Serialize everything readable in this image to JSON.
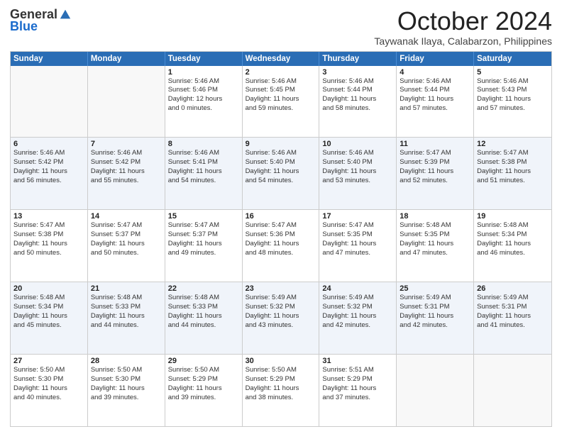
{
  "logo": {
    "general": "General",
    "blue": "Blue"
  },
  "title": "October 2024",
  "subtitle": "Taywanak Ilaya, Calabarzon, Philippines",
  "headers": [
    "Sunday",
    "Monday",
    "Tuesday",
    "Wednesday",
    "Thursday",
    "Friday",
    "Saturday"
  ],
  "weeks": [
    [
      {
        "day": "",
        "sunrise": "",
        "sunset": "",
        "daylight": "",
        "mins": "",
        "empty": true
      },
      {
        "day": "",
        "sunrise": "",
        "sunset": "",
        "daylight": "",
        "mins": "",
        "empty": true
      },
      {
        "day": "1",
        "sunrise": "Sunrise: 5:46 AM",
        "sunset": "Sunset: 5:46 PM",
        "daylight": "Daylight: 12 hours",
        "mins": "and 0 minutes."
      },
      {
        "day": "2",
        "sunrise": "Sunrise: 5:46 AM",
        "sunset": "Sunset: 5:45 PM",
        "daylight": "Daylight: 11 hours",
        "mins": "and 59 minutes."
      },
      {
        "day": "3",
        "sunrise": "Sunrise: 5:46 AM",
        "sunset": "Sunset: 5:44 PM",
        "daylight": "Daylight: 11 hours",
        "mins": "and 58 minutes."
      },
      {
        "day": "4",
        "sunrise": "Sunrise: 5:46 AM",
        "sunset": "Sunset: 5:44 PM",
        "daylight": "Daylight: 11 hours",
        "mins": "and 57 minutes."
      },
      {
        "day": "5",
        "sunrise": "Sunrise: 5:46 AM",
        "sunset": "Sunset: 5:43 PM",
        "daylight": "Daylight: 11 hours",
        "mins": "and 57 minutes."
      }
    ],
    [
      {
        "day": "6",
        "sunrise": "Sunrise: 5:46 AM",
        "sunset": "Sunset: 5:42 PM",
        "daylight": "Daylight: 11 hours",
        "mins": "and 56 minutes."
      },
      {
        "day": "7",
        "sunrise": "Sunrise: 5:46 AM",
        "sunset": "Sunset: 5:42 PM",
        "daylight": "Daylight: 11 hours",
        "mins": "and 55 minutes."
      },
      {
        "day": "8",
        "sunrise": "Sunrise: 5:46 AM",
        "sunset": "Sunset: 5:41 PM",
        "daylight": "Daylight: 11 hours",
        "mins": "and 54 minutes."
      },
      {
        "day": "9",
        "sunrise": "Sunrise: 5:46 AM",
        "sunset": "Sunset: 5:40 PM",
        "daylight": "Daylight: 11 hours",
        "mins": "and 54 minutes."
      },
      {
        "day": "10",
        "sunrise": "Sunrise: 5:46 AM",
        "sunset": "Sunset: 5:40 PM",
        "daylight": "Daylight: 11 hours",
        "mins": "and 53 minutes."
      },
      {
        "day": "11",
        "sunrise": "Sunrise: 5:47 AM",
        "sunset": "Sunset: 5:39 PM",
        "daylight": "Daylight: 11 hours",
        "mins": "and 52 minutes."
      },
      {
        "day": "12",
        "sunrise": "Sunrise: 5:47 AM",
        "sunset": "Sunset: 5:38 PM",
        "daylight": "Daylight: 11 hours",
        "mins": "and 51 minutes."
      }
    ],
    [
      {
        "day": "13",
        "sunrise": "Sunrise: 5:47 AM",
        "sunset": "Sunset: 5:38 PM",
        "daylight": "Daylight: 11 hours",
        "mins": "and 50 minutes."
      },
      {
        "day": "14",
        "sunrise": "Sunrise: 5:47 AM",
        "sunset": "Sunset: 5:37 PM",
        "daylight": "Daylight: 11 hours",
        "mins": "and 50 minutes."
      },
      {
        "day": "15",
        "sunrise": "Sunrise: 5:47 AM",
        "sunset": "Sunset: 5:37 PM",
        "daylight": "Daylight: 11 hours",
        "mins": "and 49 minutes."
      },
      {
        "day": "16",
        "sunrise": "Sunrise: 5:47 AM",
        "sunset": "Sunset: 5:36 PM",
        "daylight": "Daylight: 11 hours",
        "mins": "and 48 minutes."
      },
      {
        "day": "17",
        "sunrise": "Sunrise: 5:47 AM",
        "sunset": "Sunset: 5:35 PM",
        "daylight": "Daylight: 11 hours",
        "mins": "and 47 minutes."
      },
      {
        "day": "18",
        "sunrise": "Sunrise: 5:48 AM",
        "sunset": "Sunset: 5:35 PM",
        "daylight": "Daylight: 11 hours",
        "mins": "and 47 minutes."
      },
      {
        "day": "19",
        "sunrise": "Sunrise: 5:48 AM",
        "sunset": "Sunset: 5:34 PM",
        "daylight": "Daylight: 11 hours",
        "mins": "and 46 minutes."
      }
    ],
    [
      {
        "day": "20",
        "sunrise": "Sunrise: 5:48 AM",
        "sunset": "Sunset: 5:34 PM",
        "daylight": "Daylight: 11 hours",
        "mins": "and 45 minutes."
      },
      {
        "day": "21",
        "sunrise": "Sunrise: 5:48 AM",
        "sunset": "Sunset: 5:33 PM",
        "daylight": "Daylight: 11 hours",
        "mins": "and 44 minutes."
      },
      {
        "day": "22",
        "sunrise": "Sunrise: 5:48 AM",
        "sunset": "Sunset: 5:33 PM",
        "daylight": "Daylight: 11 hours",
        "mins": "and 44 minutes."
      },
      {
        "day": "23",
        "sunrise": "Sunrise: 5:49 AM",
        "sunset": "Sunset: 5:32 PM",
        "daylight": "Daylight: 11 hours",
        "mins": "and 43 minutes."
      },
      {
        "day": "24",
        "sunrise": "Sunrise: 5:49 AM",
        "sunset": "Sunset: 5:32 PM",
        "daylight": "Daylight: 11 hours",
        "mins": "and 42 minutes."
      },
      {
        "day": "25",
        "sunrise": "Sunrise: 5:49 AM",
        "sunset": "Sunset: 5:31 PM",
        "daylight": "Daylight: 11 hours",
        "mins": "and 42 minutes."
      },
      {
        "day": "26",
        "sunrise": "Sunrise: 5:49 AM",
        "sunset": "Sunset: 5:31 PM",
        "daylight": "Daylight: 11 hours",
        "mins": "and 41 minutes."
      }
    ],
    [
      {
        "day": "27",
        "sunrise": "Sunrise: 5:50 AM",
        "sunset": "Sunset: 5:30 PM",
        "daylight": "Daylight: 11 hours",
        "mins": "and 40 minutes."
      },
      {
        "day": "28",
        "sunrise": "Sunrise: 5:50 AM",
        "sunset": "Sunset: 5:30 PM",
        "daylight": "Daylight: 11 hours",
        "mins": "and 39 minutes."
      },
      {
        "day": "29",
        "sunrise": "Sunrise: 5:50 AM",
        "sunset": "Sunset: 5:29 PM",
        "daylight": "Daylight: 11 hours",
        "mins": "and 39 minutes."
      },
      {
        "day": "30",
        "sunrise": "Sunrise: 5:50 AM",
        "sunset": "Sunset: 5:29 PM",
        "daylight": "Daylight: 11 hours",
        "mins": "and 38 minutes."
      },
      {
        "day": "31",
        "sunrise": "Sunrise: 5:51 AM",
        "sunset": "Sunset: 5:29 PM",
        "daylight": "Daylight: 11 hours",
        "mins": "and 37 minutes."
      },
      {
        "day": "",
        "sunrise": "",
        "sunset": "",
        "daylight": "",
        "mins": "",
        "empty": true
      },
      {
        "day": "",
        "sunrise": "",
        "sunset": "",
        "daylight": "",
        "mins": "",
        "empty": true
      }
    ]
  ]
}
